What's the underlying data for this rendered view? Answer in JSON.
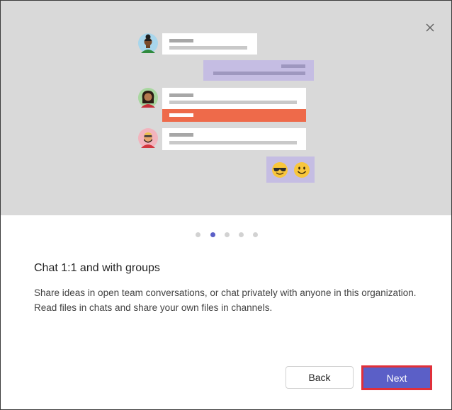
{
  "dialog": {
    "close_label": "Close",
    "title": "Chat 1:1 and with groups",
    "description": "Share ideas in open team conversations, or chat privately with anyone in this organization. Read files in chats and share your own files in channels.",
    "pagination": {
      "total": 5,
      "current": 2
    },
    "buttons": {
      "back": "Back",
      "next": "Next"
    }
  },
  "colors": {
    "accent": "#5b5fc7",
    "highlight_border": "#e0303a",
    "hero_background": "#d9d9d9",
    "orange_bar": "#ee6a4a",
    "purple_bubble": "#c5bde3"
  },
  "illustration": {
    "icons": [
      "avatar-person-1-icon",
      "avatar-person-2-icon",
      "avatar-person-3-icon",
      "sunglasses-emoji-icon",
      "smiley-emoji-icon"
    ]
  }
}
